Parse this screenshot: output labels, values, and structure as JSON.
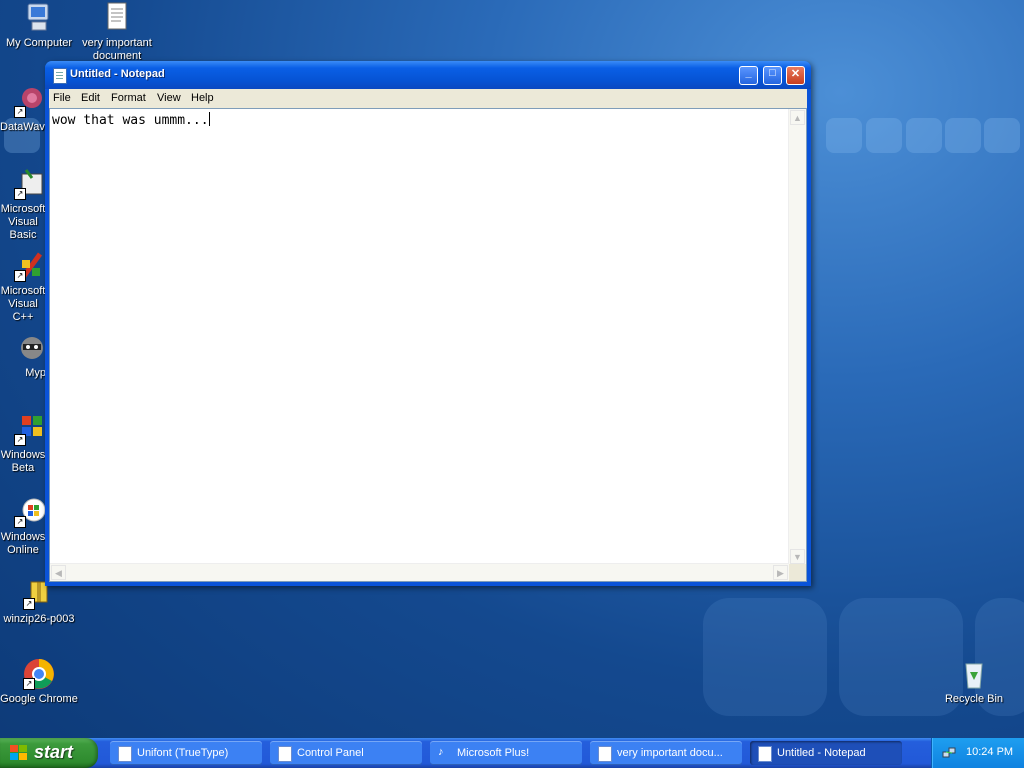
{
  "desktop": {
    "icons": [
      {
        "label": "My Computer"
      },
      {
        "label": "very important document"
      },
      {
        "label": "DataWave"
      },
      {
        "label": "Microsoft Visual Basic"
      },
      {
        "label": "Microsoft Visual C++"
      },
      {
        "label": "Myp"
      },
      {
        "label": "Windows Beta"
      },
      {
        "label": "Windows Online"
      },
      {
        "label": "winzip26-p003"
      },
      {
        "label": "Google Chrome"
      },
      {
        "label": "Recycle Bin"
      }
    ]
  },
  "notepad": {
    "title": "Untitled - Notepad",
    "menu": [
      "File",
      "Edit",
      "Format",
      "View",
      "Help"
    ],
    "content": "wow that was ummm...",
    "controls": {
      "minimize": "_",
      "maximize": "□",
      "close": "✕"
    }
  },
  "taskbar": {
    "start_label": "start",
    "tasks": [
      {
        "label": "Unifont (TrueType)",
        "icon": "font-file-icon"
      },
      {
        "label": "Control Panel",
        "icon": "control-panel-icon"
      },
      {
        "label": "Microsoft Plus!",
        "icon": "plus-icon"
      },
      {
        "label": "very important docu...",
        "icon": "notepad-icon"
      },
      {
        "label": "Untitled - Notepad",
        "icon": "notepad-icon",
        "active": true
      }
    ],
    "clock": "10:24 PM"
  }
}
